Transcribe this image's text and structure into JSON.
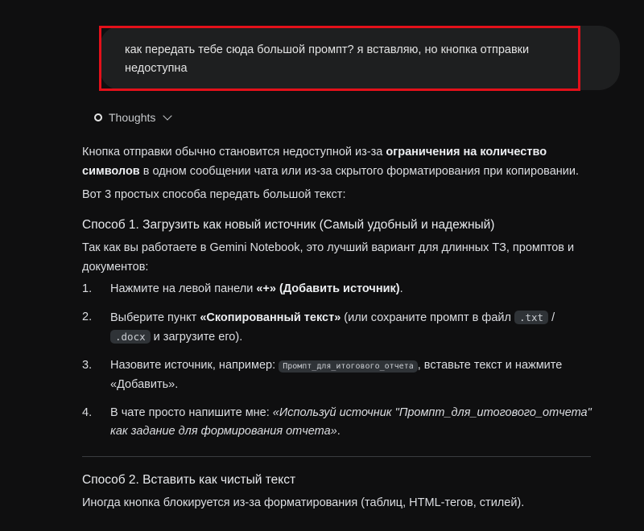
{
  "user_message": {
    "line1": "как передать тебе сюда большой промпт? я вставляю, но кнопка отправки",
    "line2": "недоступна"
  },
  "thoughts": {
    "label": "Thoughts"
  },
  "response": {
    "p1_a": "Кнопка отправки обычно становится недоступной из-за ",
    "p1_b": "ограничения на количество символов",
    "p1_c": " в одном сообщении чата или из-за скрытого форматирования при копировании.",
    "p2": "Вот 3 простых способа передать большой текст:",
    "h1": "Способ 1. Загрузить как новый источник (Самый удобный и надежный)",
    "p3": "Так как вы работаете в Gemini Notebook, это лучший вариант для длинных ТЗ, промптов и документов:",
    "steps": {
      "s1_num": "1.",
      "s1_a": "Нажмите на левой панели ",
      "s1_b": "«+» (Добавить источник)",
      "s1_c": ".",
      "s2_num": "2.",
      "s2_a": "Выберите пункт ",
      "s2_b": "«Скопированный текст»",
      "s2_c": " (или сохраните промпт в файл ",
      "s2_code1": ".txt",
      "s2_d": " / ",
      "s2_code2": ".docx",
      "s2_e": " и загрузите его).",
      "s3_num": "3.",
      "s3_a": "Назовите источник, например: ",
      "s3_code": "Промпт_для_итогового_отчета",
      "s3_b": ", вставьте текст и нажмите «Добавить».",
      "s4_num": "4.",
      "s4_a": "В чате просто напишите мне: ",
      "s4_b": "«Используй источник \"Промпт_для_итогового_отчета\" как задание для формирования отчета»",
      "s4_c": "."
    },
    "h2": "Способ 2. Вставить как чистый текст",
    "p4": "Иногда кнопка блокируется из-за форматирования (таблиц, HTML-тегов, стилей)."
  },
  "colors": {
    "background": "#0f0f10",
    "bubble": "#1e1f20",
    "highlight": "#e3101a",
    "code_bg": "#2f3337"
  }
}
